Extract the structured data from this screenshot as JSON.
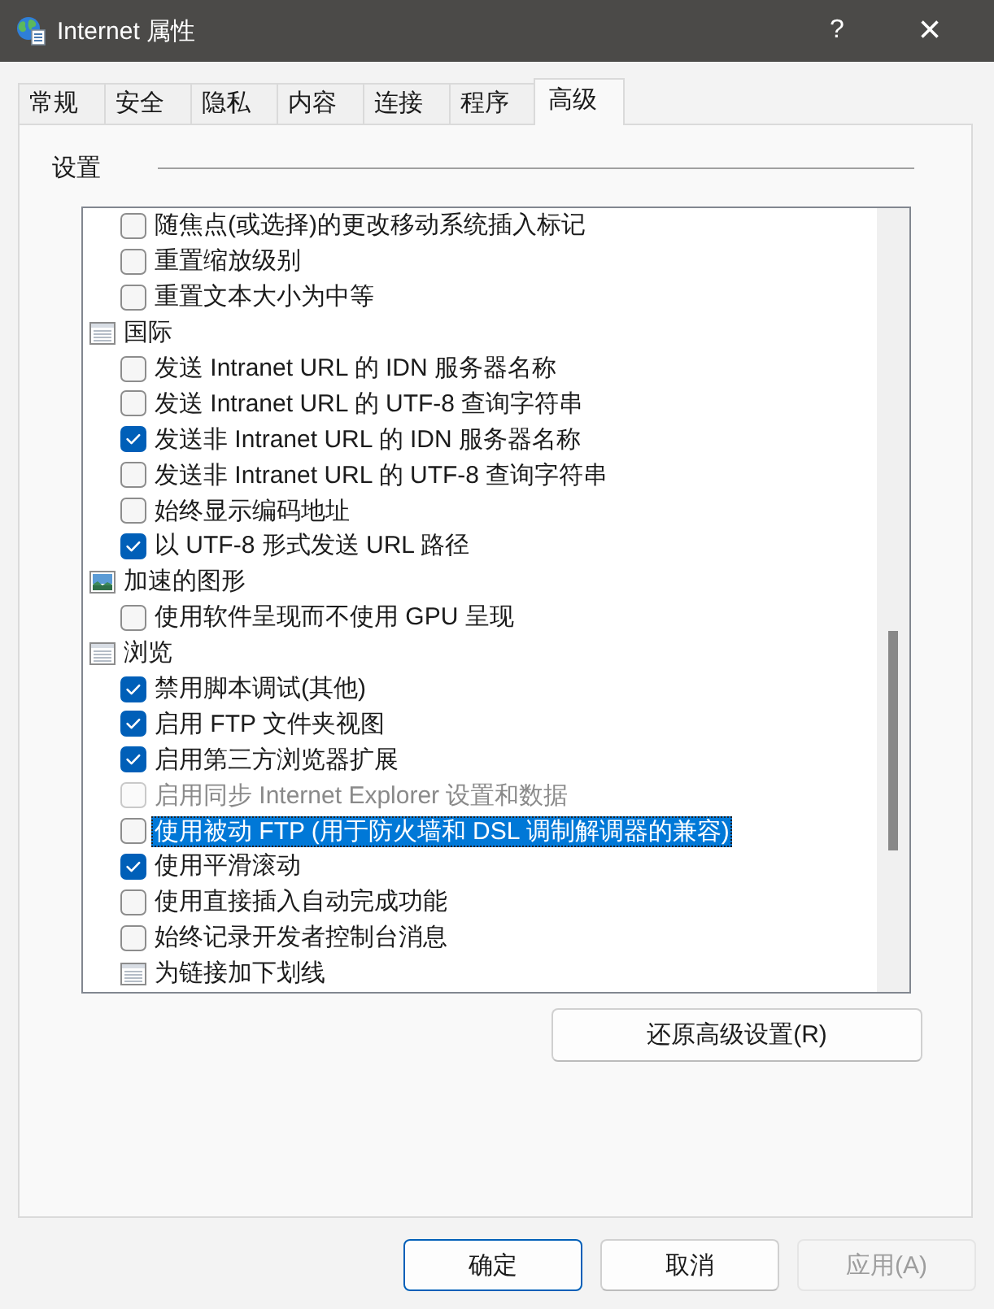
{
  "window": {
    "title": "Internet 属性",
    "help_button": "?",
    "close_button": "×"
  },
  "tabs": [
    {
      "label": "常规",
      "selected": false
    },
    {
      "label": "安全",
      "selected": false
    },
    {
      "label": "隐私",
      "selected": false
    },
    {
      "label": "内容",
      "selected": false
    },
    {
      "label": "连接",
      "selected": false
    },
    {
      "label": "程序",
      "selected": false
    },
    {
      "label": "高级",
      "selected": true
    }
  ],
  "settings": {
    "label": "设置",
    "items": [
      {
        "kind": "group",
        "children": [
          {
            "kind": "checkbox",
            "label": "随焦点(或选择)的更改移动系统插入标记",
            "checked": false,
            "disabled": false,
            "selected": false
          },
          {
            "kind": "checkbox",
            "label": "重置缩放级别",
            "checked": false,
            "disabled": false,
            "selected": false
          },
          {
            "kind": "checkbox",
            "label": "重置文本大小为中等",
            "checked": false,
            "disabled": false,
            "selected": false
          }
        ]
      },
      {
        "kind": "group",
        "label": "国际",
        "selected": false,
        "children": [
          {
            "kind": "checkbox",
            "label": "发送 Intranet URL 的 IDN 服务器名称",
            "checked": false,
            "disabled": false,
            "selected": false
          },
          {
            "kind": "checkbox",
            "label": "发送 Intranet URL 的 UTF-8 查询字符串",
            "checked": false,
            "disabled": false,
            "selected": false
          },
          {
            "kind": "checkbox",
            "label": "发送非 Intranet URL 的 IDN 服务器名称",
            "checked": true,
            "disabled": false,
            "selected": false
          },
          {
            "kind": "checkbox",
            "label": "发送非 Intranet URL 的 UTF-8 查询字符串",
            "checked": false,
            "disabled": false,
            "selected": false
          },
          {
            "kind": "checkbox",
            "label": "始终显示编码地址",
            "checked": false,
            "disabled": false,
            "selected": false
          },
          {
            "kind": "checkbox",
            "label": "以 UTF-8 形式发送 URL 路径",
            "checked": true,
            "disabled": false,
            "selected": false
          }
        ]
      },
      {
        "kind": "picture-group",
        "label": "加速的图形",
        "selected": false,
        "children": [
          {
            "kind": "checkbox",
            "label": "使用软件呈现而不使用 GPU 呈现",
            "checked": false,
            "disabled": false,
            "selected": false
          }
        ]
      },
      {
        "kind": "group",
        "label": "浏览",
        "selected": false,
        "children": [
          {
            "kind": "checkbox",
            "label": "禁用脚本调试(其他)",
            "checked": true,
            "disabled": false,
            "selected": false
          },
          {
            "kind": "checkbox",
            "label": "启用 FTP 文件夹视图",
            "checked": true,
            "disabled": false,
            "selected": false
          },
          {
            "kind": "checkbox",
            "label": "启用第三方浏览器扩展",
            "checked": true,
            "disabled": false,
            "selected": false
          },
          {
            "kind": "checkbox",
            "label": "启用同步 Internet Explorer 设置和数据",
            "checked": false,
            "disabled": true,
            "selected": false
          },
          {
            "kind": "checkbox",
            "label": "使用被动 FTP (用于防火墙和 DSL 调制解调器的兼容)",
            "checked": false,
            "disabled": false,
            "selected": true
          },
          {
            "kind": "checkbox",
            "label": "使用平滑滚动",
            "checked": true,
            "disabled": false,
            "selected": false
          },
          {
            "kind": "checkbox",
            "label": "使用直接插入自动完成功能",
            "checked": false,
            "disabled": false,
            "selected": false
          },
          {
            "kind": "checkbox",
            "label": "始终记录开发者控制台消息",
            "checked": false,
            "disabled": false,
            "selected": false
          },
          {
            "kind": "group",
            "label": "为链接加下划线",
            "selected": false
          }
        ]
      }
    ]
  },
  "reset_button": "还原高级设置(R)",
  "buttons": [
    {
      "label": "确定",
      "default": true,
      "disabled": false
    },
    {
      "label": "取消",
      "default": false,
      "disabled": false
    },
    {
      "label": "应用(A)",
      "default": false,
      "disabled": true
    }
  ]
}
